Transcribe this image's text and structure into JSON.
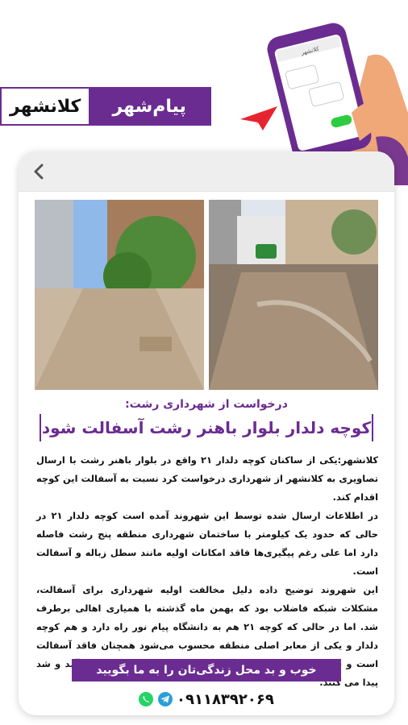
{
  "brand": {
    "name_part1": "پیام‌شهر",
    "name_part2": "کلانشهر",
    "accent_color": "#6b2c91"
  },
  "header_illustration": {
    "phone_screen_label": "کلانشهر",
    "icons": [
      "hand-holding-phone-icon",
      "paper-plane-icon"
    ]
  },
  "nav": {
    "back_icon": "chevron-left-icon"
  },
  "article": {
    "subtitle": "درخواست از شهرداری رشت:",
    "headline": "کوچه دلدار بلوار باهنر رشت آسفالت شود",
    "paragraphs": [
      "کلانشهر:یکی از ساکنان کوچه دلدار ۲۱ واقع در بلوار باهنر رشت با ارسال تصاویری به کلانشهر از شهرداری درخواست کرد نسبت به آسفالت این کوچه اقدام کند.",
      "در اطلاعات ارسال شده توسط این شهروند آمده است کوچه دلدار ۲۱ در حالی که حدود یک کیلومتر با ساختمان شهرداری منطقه پنج رشت فاصله دارد اما علی رغم پیگیری‌ها فاقد امکانات اولیه مانند سطل زباله و آسفالت است.",
      "این شهروند توضیح داده دلیل مخالفت اولیه شهرداری برای آسفالت، مشکلات شبکه فاضلاب بود که بهمن ماه گذشته با همیاری اهالی برطرف شد. اما در حالی که کوچه ۲۱ هم به دانشگاه پیام نور راه دارد و هم کوچه دلدار و یکی از معابر اصلی منطقه محسوب می‌شود همچنان فاقد آسفالت است و ساکنانش در زمان بارندگی شرایط بسیار نامناسبی برای آمد و شد پیدا می کنند."
    ]
  },
  "footer": {
    "cta": "خوب و بد محل زندگی‌تان را به ما بگویید",
    "phone": "۰۹۱۱۸۳۹۲۰۶۹",
    "icons": [
      "whatsapp-icon",
      "telegram-icon"
    ],
    "whatsapp_color": "#25d366",
    "telegram_color": "#2a9fd8"
  }
}
